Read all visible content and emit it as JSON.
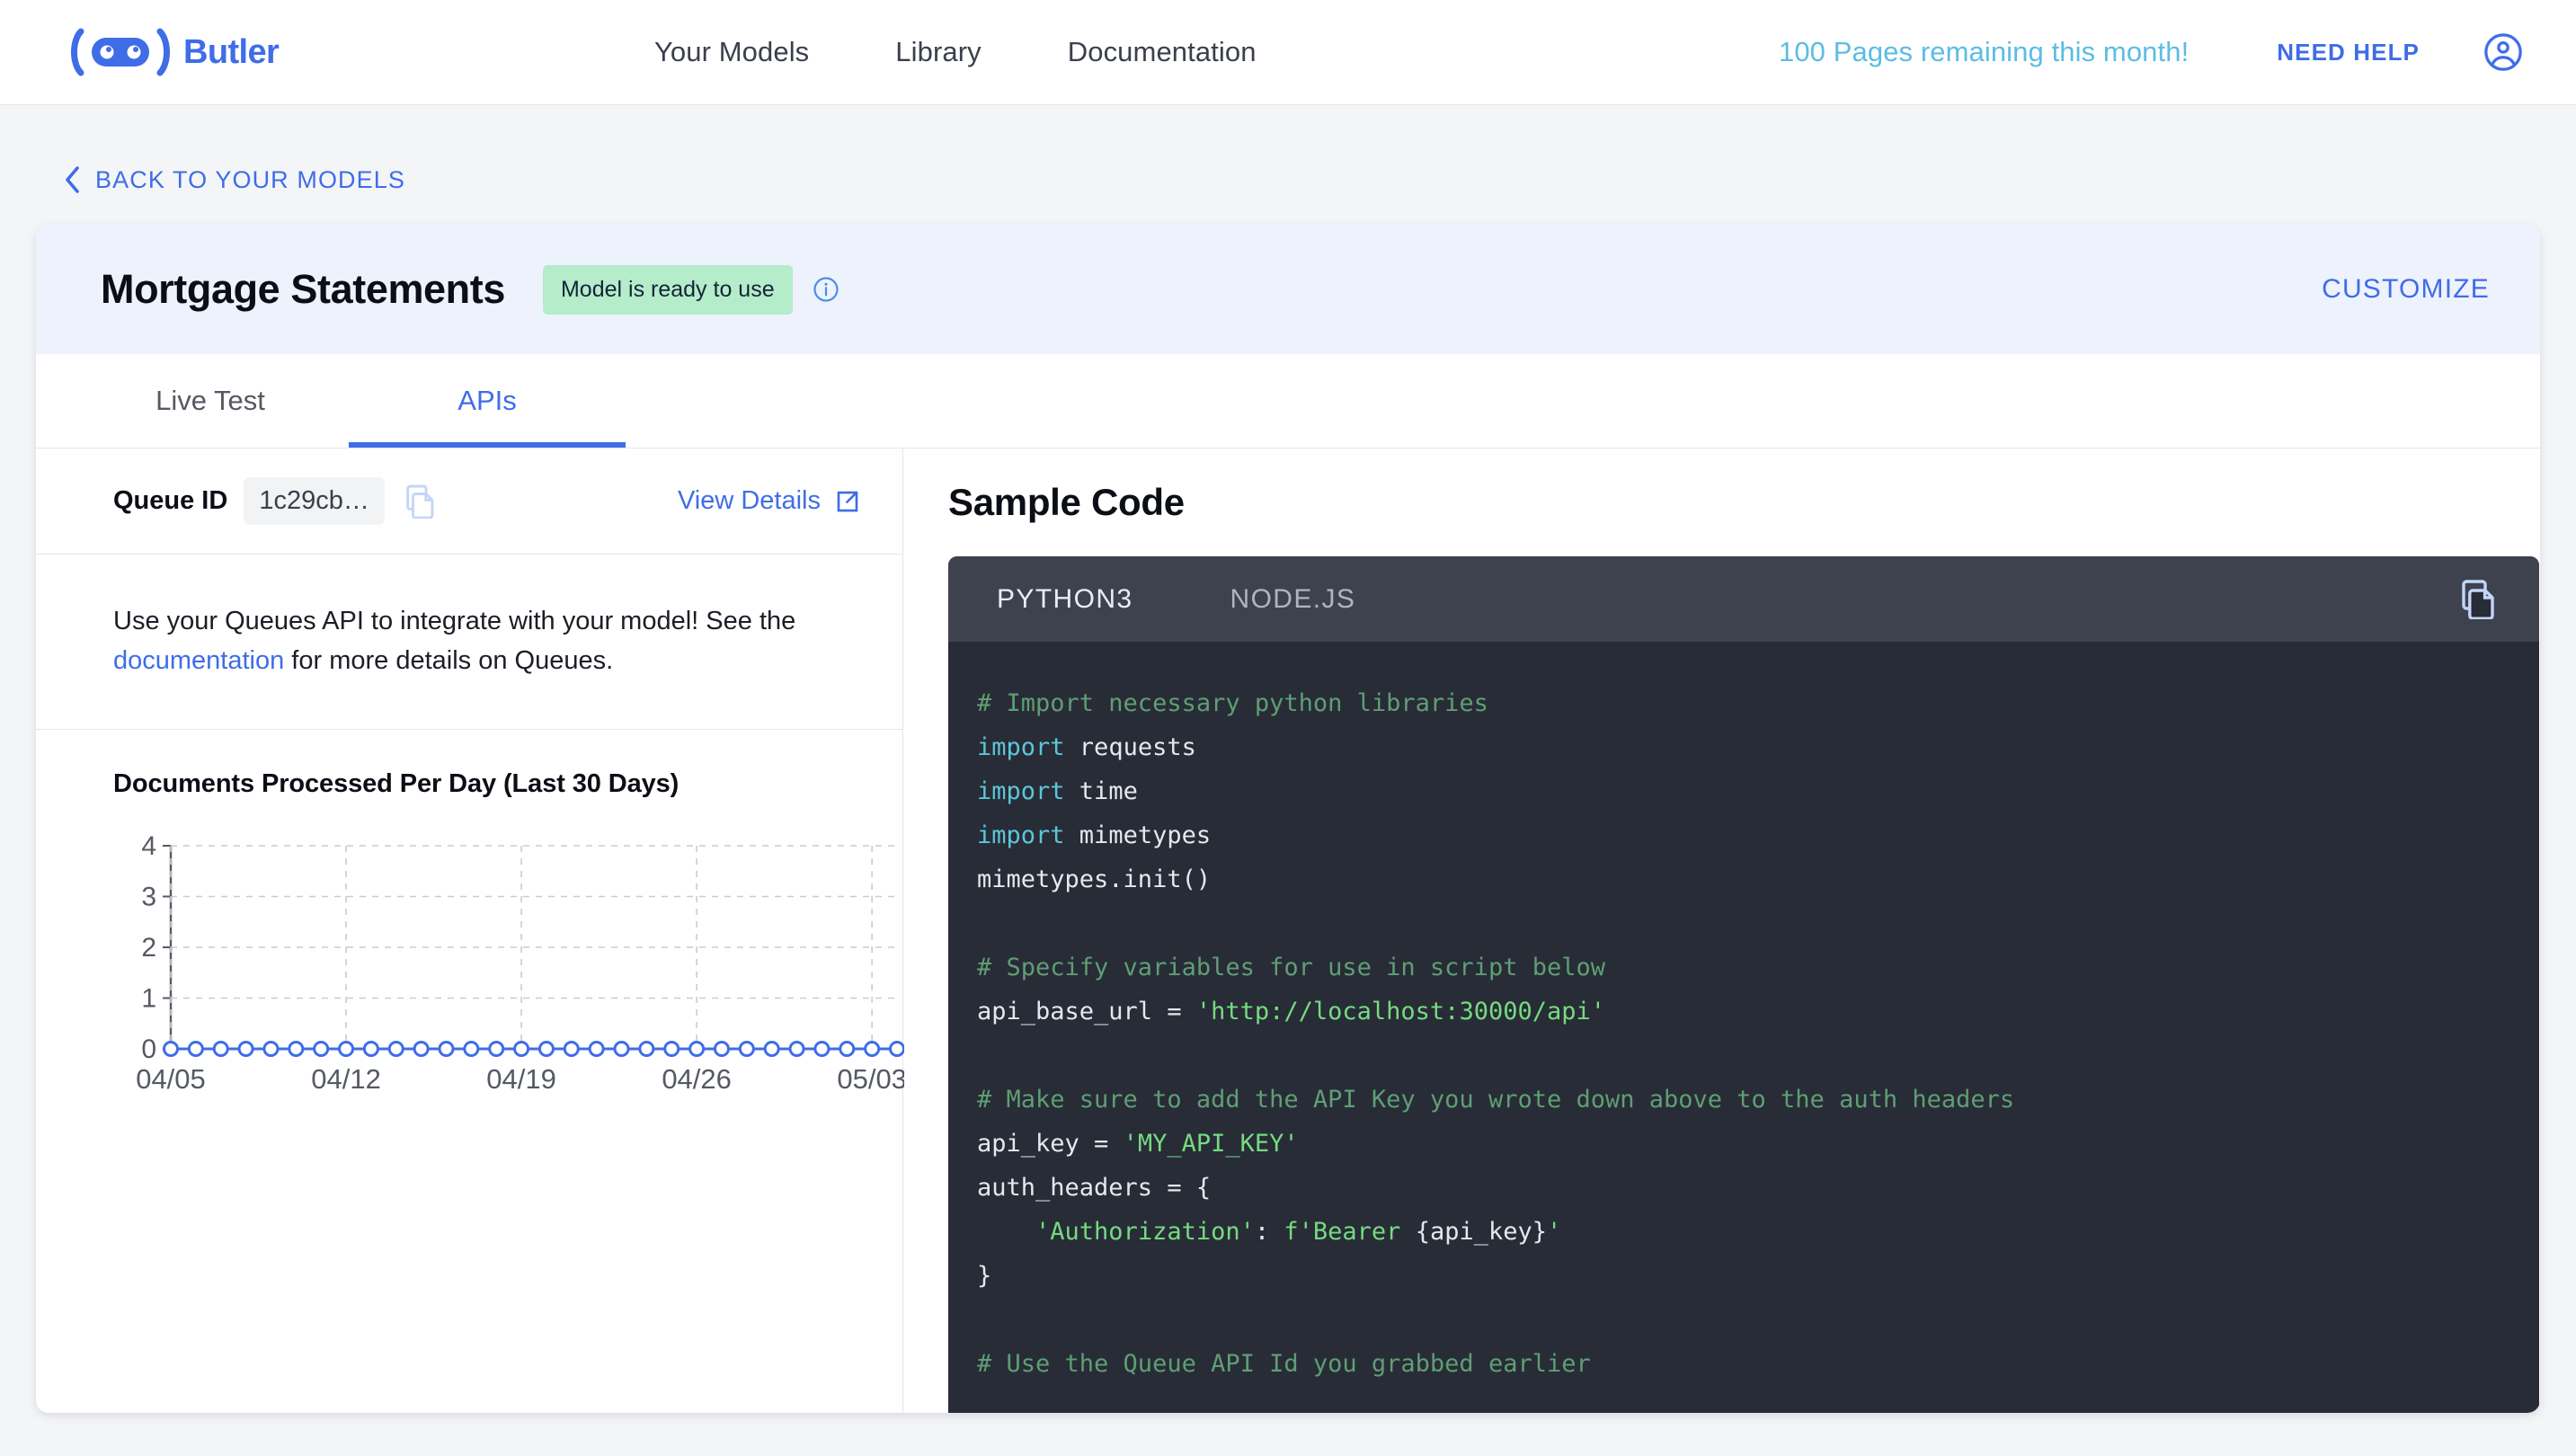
{
  "brand": {
    "name": "Butler"
  },
  "topnav": {
    "links": [
      {
        "label": "Your Models"
      },
      {
        "label": "Library"
      },
      {
        "label": "Documentation"
      }
    ],
    "pages_remaining": "100 Pages remaining this month!",
    "need_help": "NEED HELP"
  },
  "back_link": {
    "label": "BACK TO YOUR MODELS"
  },
  "card_header": {
    "title": "Mortgage Statements",
    "status_badge": "Model is ready to use",
    "customize": "CUSTOMIZE"
  },
  "tabs": [
    {
      "label": "Live Test",
      "active": false
    },
    {
      "label": "APIs",
      "active": true
    }
  ],
  "queue": {
    "label": "Queue ID",
    "value": "1c29cb…",
    "view_details": "View Details"
  },
  "description": {
    "before": "Use your Queues API to integrate with your model! See the ",
    "link": "documentation",
    "after": " for more details on Queues."
  },
  "chart_data": {
    "type": "line",
    "title": "Documents Processed Per Day (Last 30 Days)",
    "xlabel": "",
    "ylabel": "",
    "ylim": [
      0,
      4
    ],
    "yticks": [
      0,
      1,
      2,
      3,
      4
    ],
    "grid": true,
    "legend": false,
    "x_tick_labels": [
      "04/05",
      "04/12",
      "04/19",
      "04/26",
      "05/03"
    ],
    "x_tick_indices": [
      0,
      7,
      14,
      21,
      28
    ],
    "x": [
      "04/05",
      "04/06",
      "04/07",
      "04/08",
      "04/09",
      "04/10",
      "04/11",
      "04/12",
      "04/13",
      "04/14",
      "04/15",
      "04/16",
      "04/17",
      "04/18",
      "04/19",
      "04/20",
      "04/21",
      "04/22",
      "04/23",
      "04/24",
      "04/25",
      "04/26",
      "04/27",
      "04/28",
      "04/29",
      "04/30",
      "05/01",
      "05/02",
      "05/03",
      "05/04"
    ],
    "values": [
      0,
      0,
      0,
      0,
      0,
      0,
      0,
      0,
      0,
      0,
      0,
      0,
      0,
      0,
      0,
      0,
      0,
      0,
      0,
      0,
      0,
      0,
      0,
      0,
      0,
      0,
      0,
      0,
      0,
      0
    ],
    "series_color": "#3F6DE8",
    "marker": "circle"
  },
  "sample_code": {
    "heading": "Sample Code",
    "tabs": [
      {
        "label": "PYTHON3",
        "active": true
      },
      {
        "label": "NODE.JS",
        "active": false
      }
    ],
    "lines": [
      [
        {
          "t": "comment",
          "s": "# Import necessary python libraries"
        }
      ],
      [
        {
          "t": "keyword",
          "s": "import"
        },
        {
          "t": "plain",
          "s": " requests"
        }
      ],
      [
        {
          "t": "keyword",
          "s": "import"
        },
        {
          "t": "plain",
          "s": " time"
        }
      ],
      [
        {
          "t": "keyword",
          "s": "import"
        },
        {
          "t": "plain",
          "s": " mimetypes"
        }
      ],
      [
        {
          "t": "plain",
          "s": "mimetypes.init()"
        }
      ],
      [
        {
          "t": "plain",
          "s": ""
        }
      ],
      [
        {
          "t": "comment",
          "s": "# Specify variables for use in script below"
        }
      ],
      [
        {
          "t": "plain",
          "s": "api_base_url = "
        },
        {
          "t": "string",
          "s": "'http://localhost:30000/api'"
        }
      ],
      [
        {
          "t": "plain",
          "s": ""
        }
      ],
      [
        {
          "t": "comment",
          "s": "# Make sure to add the API Key you wrote down above to the auth headers"
        }
      ],
      [
        {
          "t": "plain",
          "s": "api_key = "
        },
        {
          "t": "string",
          "s": "'MY_API_KEY'"
        }
      ],
      [
        {
          "t": "plain",
          "s": "auth_headers = {"
        }
      ],
      [
        {
          "t": "plain",
          "s": "    "
        },
        {
          "t": "string",
          "s": "'Authorization'"
        },
        {
          "t": "plain",
          "s": ": "
        },
        {
          "t": "string",
          "s": "f'Bearer "
        },
        {
          "t": "plain",
          "s": "{api_key}"
        },
        {
          "t": "string",
          "s": "'"
        }
      ],
      [
        {
          "t": "plain",
          "s": "}"
        }
      ],
      [
        {
          "t": "plain",
          "s": ""
        }
      ],
      [
        {
          "t": "comment",
          "s": "# Use the Queue API Id you grabbed earlier"
        }
      ]
    ]
  },
  "colors": {
    "brand_blue": "#3F6DE8",
    "cyan": "#5BBDE4",
    "badge_green": "#B5ECC9",
    "page_bg": "#F4F5F7",
    "card_header_bg": "#EEF2FD",
    "code_bg": "#282C37",
    "code_tabbar_bg": "#3D424E"
  }
}
